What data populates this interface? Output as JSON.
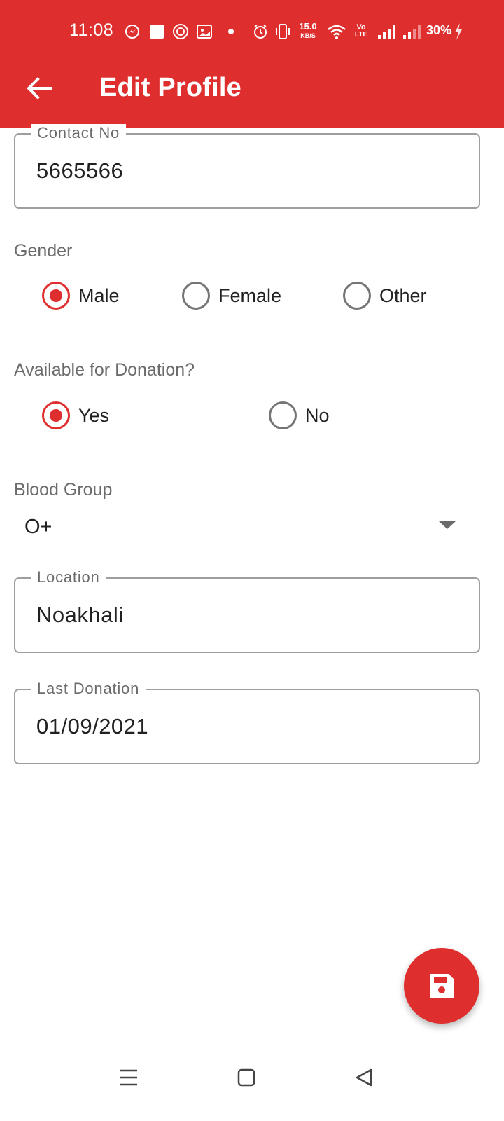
{
  "status_bar": {
    "time": "11:08",
    "net_speed_top": "15.0",
    "net_speed_unit": "KB/S",
    "volte_top": "Vo",
    "volte_bottom": "LTE",
    "battery": "30%",
    "icons": [
      "messenger-icon",
      "square-notification-icon",
      "app-notification-icon",
      "gallery-icon",
      "dot-icon",
      "alarm-icon",
      "vibrate-icon",
      "wifi-icon",
      "signal-icon",
      "signal-weak-icon",
      "charging-icon"
    ]
  },
  "app_bar": {
    "title": "Edit Profile",
    "back_icon": "arrow-left-icon",
    "color": "#DF2E2E"
  },
  "form": {
    "contact": {
      "label": "Contact No",
      "value": "5665566"
    },
    "gender": {
      "label": "Gender",
      "options": [
        {
          "label": "Male",
          "checked": true
        },
        {
          "label": "Female",
          "checked": false
        },
        {
          "label": "Other",
          "checked": false
        }
      ]
    },
    "donation": {
      "label": "Available for Donation?",
      "options": [
        {
          "label": "Yes",
          "checked": true
        },
        {
          "label": "No",
          "checked": false
        }
      ]
    },
    "blood_group": {
      "label": "Blood Group",
      "value": "O+"
    },
    "location": {
      "label": "Location",
      "value": "Noakhali"
    },
    "last_donation": {
      "label": "Last Donation",
      "value": "01/09/2021"
    }
  },
  "fab": {
    "icon": "save-icon"
  },
  "nav_bar": {
    "icons": [
      "menu-icon",
      "home-icon",
      "back-icon"
    ]
  }
}
